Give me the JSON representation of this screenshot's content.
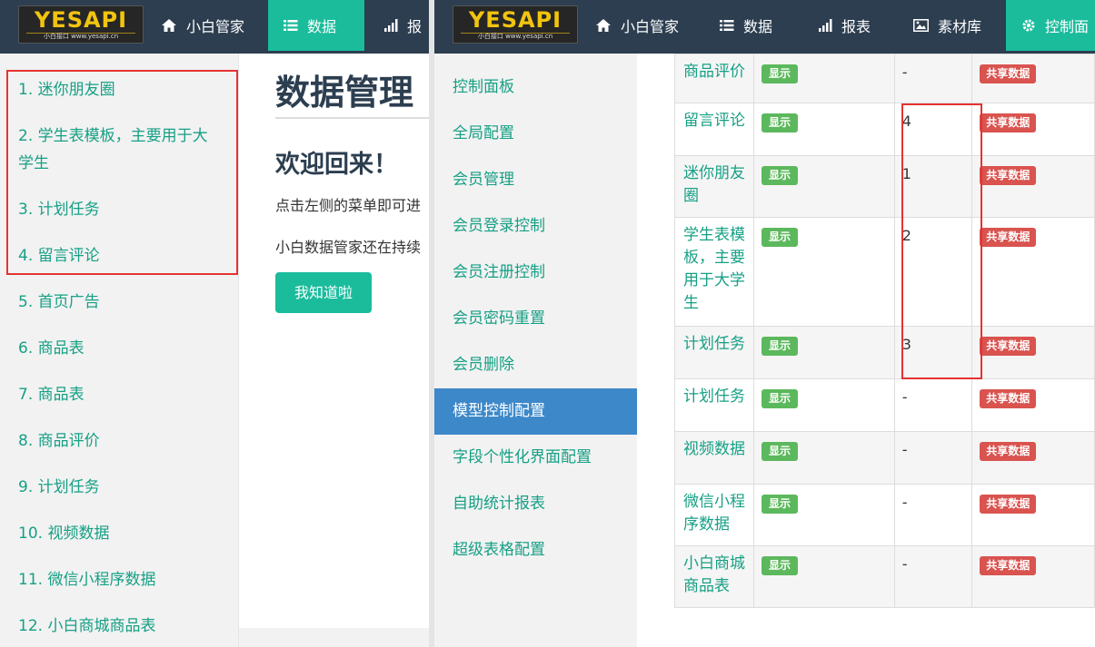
{
  "left_window": {
    "logo": {
      "brand": "YESAPI",
      "sub": "小白接口 www.yesapi.cn"
    },
    "nav": [
      {
        "label": "小白管家",
        "icon": "home-icon"
      },
      {
        "label": "数据",
        "icon": "list-icon"
      },
      {
        "label": "报",
        "icon": "bar-chart-icon"
      }
    ],
    "sidebar": [
      "1. 迷你朋友圈",
      "2. 学生表模板，主要用于大学生",
      "3. 计划任务",
      "4. 留言评论",
      "5. 首页广告",
      "6. 商品表",
      "7. 商品表",
      "8. 商品评价",
      "9. 计划任务",
      "10. 视频数据",
      "11. 微信小程序数据",
      "12. 小白商城商品表"
    ],
    "main": {
      "title": "数据管理",
      "welcome": "欢迎回来！",
      "line1": "点击左侧的菜单即可进",
      "line2": "小白数据管家还在持续",
      "button": "我知道啦"
    }
  },
  "right_window": {
    "logo": {
      "brand": "YESAPI",
      "sub": "小白接口 www.yesapi.cn"
    },
    "nav": [
      {
        "label": "小白管家",
        "icon": "home-icon"
      },
      {
        "label": "数据",
        "icon": "list-icon"
      },
      {
        "label": "报表",
        "icon": "bar-chart-icon"
      },
      {
        "label": "素材库",
        "icon": "image-icon"
      },
      {
        "label": "控制面",
        "icon": "gear-icon"
      }
    ],
    "sidebar": [
      "控制面板",
      "全局配置",
      "会员管理",
      "会员登录控制",
      "会员注册控制",
      "会员密码重置",
      "会员删除",
      "模型控制配置",
      "字段个性化界面配置",
      "自助统计报表",
      "超级表格配置"
    ],
    "sidebar_active": "模型控制配置",
    "table": [
      {
        "name": "商品评价",
        "status": "显示",
        "order": "-",
        "share": "共享数据"
      },
      {
        "name": "留言评论",
        "status": "显示",
        "order": "4",
        "share": "共享数据"
      },
      {
        "name": "迷你朋友圈",
        "status": "显示",
        "order": "1",
        "share": "共享数据"
      },
      {
        "name": "学生表模板，主要用于大学生",
        "status": "显示",
        "order": "2",
        "share": "共享数据"
      },
      {
        "name": "计划任务",
        "status": "显示",
        "order": "3",
        "share": "共享数据"
      },
      {
        "name": "计划任务",
        "status": "显示",
        "order": "-",
        "share": "共享数据"
      },
      {
        "name": "视频数据",
        "status": "显示",
        "order": "-",
        "share": "共享数据"
      },
      {
        "name": "微信小程序数据",
        "status": "显示",
        "order": "-",
        "share": "共享数据"
      },
      {
        "name": "小白商城商品表",
        "status": "显示",
        "order": "-",
        "share": "共享数据"
      }
    ]
  },
  "colors": {
    "nav_bg": "#2c3e50",
    "accent": "#1abc9c",
    "link": "#16a085",
    "active_menu": "#3d88c9",
    "highlight_box": "#e53333",
    "badge_green": "#5cb85c",
    "badge_red": "#d9534f"
  }
}
